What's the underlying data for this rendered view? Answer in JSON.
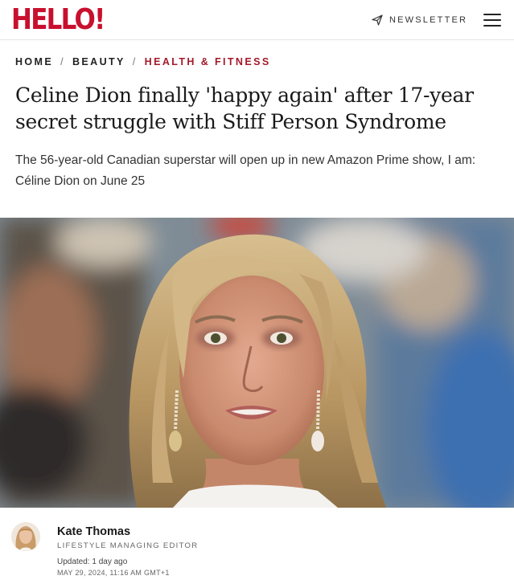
{
  "header": {
    "logo": "HELLO!",
    "newsletter_label": "NEWSLETTER",
    "brand_color": "#c8102e"
  },
  "breadcrumb": {
    "items": [
      {
        "label": "HOME"
      },
      {
        "label": "BEAUTY"
      },
      {
        "label": "HEALTH & FITNESS"
      }
    ],
    "separator": "/",
    "active_color": "#a31a2b"
  },
  "article": {
    "headline": "Celine Dion finally 'happy again' after 17-year secret struggle with Stiff Person Syndrome",
    "standfirst": "The 56-year-old Canadian superstar will open up in new Amazon Prime show, I am: Céline Dion on June 25"
  },
  "author": {
    "name": "Kate Thomas",
    "role": "LIFESTYLE MANAGING EDITOR",
    "updated": "Updated: 1 day ago",
    "date": "MAY 29, 2024, 11:16 AM GMT+1"
  }
}
